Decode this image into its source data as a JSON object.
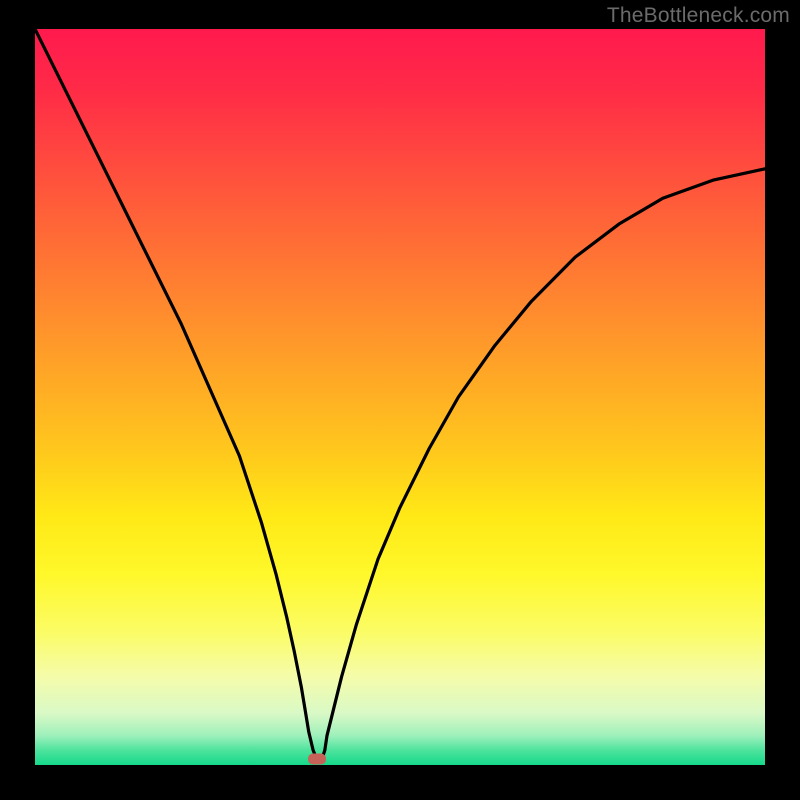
{
  "watermark": "TheBottleneck.com",
  "colors": {
    "frame": "#000000",
    "watermark_text": "#6b6b6b",
    "curve": "#000000",
    "marker": "#c76258",
    "gradient_stops": [
      {
        "offset": 0.0,
        "color": "#ff1a4e"
      },
      {
        "offset": 0.08,
        "color": "#ff2a47"
      },
      {
        "offset": 0.18,
        "color": "#ff4a3f"
      },
      {
        "offset": 0.28,
        "color": "#ff6a36"
      },
      {
        "offset": 0.38,
        "color": "#ff8a2e"
      },
      {
        "offset": 0.48,
        "color": "#ffaa25"
      },
      {
        "offset": 0.58,
        "color": "#ffca1c"
      },
      {
        "offset": 0.66,
        "color": "#ffe816"
      },
      {
        "offset": 0.74,
        "color": "#fff82a"
      },
      {
        "offset": 0.82,
        "color": "#fbfc66"
      },
      {
        "offset": 0.88,
        "color": "#f5fcaa"
      },
      {
        "offset": 0.93,
        "color": "#d9f9c6"
      },
      {
        "offset": 0.96,
        "color": "#9ef0bb"
      },
      {
        "offset": 0.98,
        "color": "#4ee39d"
      },
      {
        "offset": 1.0,
        "color": "#15d98a"
      }
    ]
  },
  "chart_data": {
    "type": "line",
    "title": "",
    "xlabel": "",
    "ylabel": "",
    "xlim": [
      0,
      100
    ],
    "ylim": [
      0,
      100
    ],
    "series": [
      {
        "name": "bottleneck-curve",
        "x": [
          0,
          5,
          10,
          15,
          20,
          24,
          28,
          31,
          33,
          34.5,
          35.5,
          36.5,
          37,
          37.5,
          38.1,
          38.6,
          39.0,
          39.3,
          39.7,
          40,
          42,
          44,
          47,
          50,
          54,
          58,
          63,
          68,
          74,
          80,
          86,
          93,
          100
        ],
        "y": [
          100,
          90,
          80,
          70,
          60,
          51,
          42,
          33,
          26,
          20,
          15.5,
          10.5,
          7.5,
          4.5,
          2.0,
          0.8,
          0.3,
          0.8,
          2.0,
          4,
          12,
          19,
          28,
          35,
          43,
          50,
          57,
          63,
          69,
          73.5,
          77,
          79.5,
          81
        ]
      }
    ],
    "marker": {
      "x": 38.6,
      "y": 0.8
    }
  }
}
